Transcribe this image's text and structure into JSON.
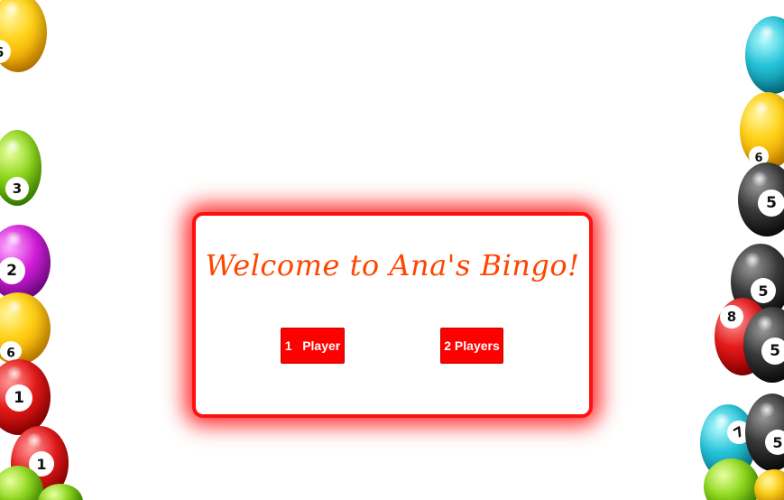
{
  "welcome": {
    "title": "Welcome to Ana's Bingo!",
    "one_player_label": "1   Player",
    "two_players_label": "2 Players"
  },
  "balls": {
    "left": [
      "9",
      "3",
      "2",
      "9",
      "1",
      "1"
    ],
    "right": [
      "5",
      "5",
      "8",
      "5",
      "7",
      "5"
    ]
  },
  "colors": {
    "accent_red": "#ff0000",
    "title_orange": "#ff4500",
    "panel_glow": "#ff1010"
  }
}
